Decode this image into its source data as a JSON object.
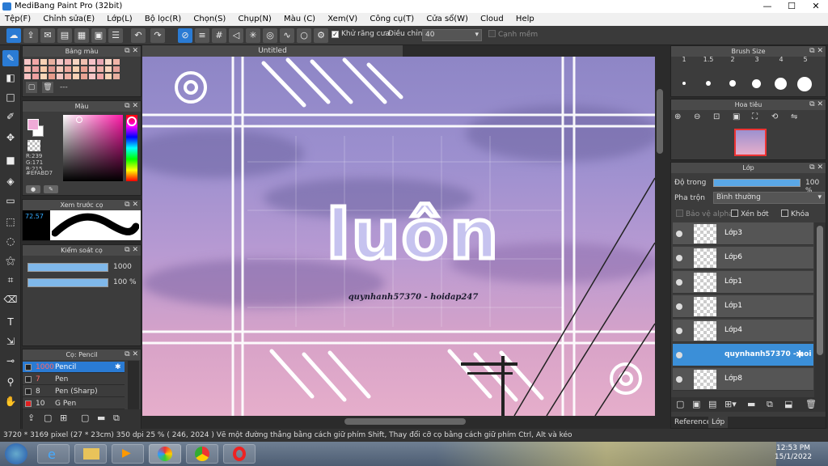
{
  "window": {
    "title": "MediBang Paint Pro (32bit)",
    "minimize": "—",
    "maximize": "☐",
    "close": "✕"
  },
  "menu": [
    "Tệp(F)",
    "Chỉnh sửa(E)",
    "Lớp(L)",
    "Bộ lọc(R)",
    "Chọn(S)",
    "Chụp(N)",
    "Màu (C)",
    "Xem(V)",
    "Công cụ(T)",
    "Cửa sổ(W)",
    "Cloud",
    "Help"
  ],
  "toolbar": {
    "antialias_label": "Khử răng cưa",
    "adjust_label": "Điều chỉnh",
    "adjust_value": "40",
    "edge_label": "Cạnh mềm"
  },
  "canvas": {
    "tab_title": "Untitled",
    "art_word": "luôn",
    "art_caption": "quynhanh57370 - hoidap247"
  },
  "palette_panel": {
    "title": "Bảng màu",
    "name": "---"
  },
  "color_panel": {
    "title": "Màu",
    "r": "R:239",
    "g": "G:171",
    "b": "B:215",
    "hex": "#EFABD7",
    "primary": "#EFABD7"
  },
  "preview_panel": {
    "title": "Xem trước cọ",
    "size": "72.57"
  },
  "control_panel": {
    "title": "Kiểm soát cọ",
    "size_value": "1000",
    "opacity_value": "100 %"
  },
  "brush_panel": {
    "title": "Cọ: Pencil",
    "brushes": [
      {
        "size": "1000",
        "name": "Pencil",
        "color": "#222222"
      },
      {
        "size": "7",
        "name": "Pen",
        "color": "#222222"
      },
      {
        "size": "8",
        "name": "Pen (Sharp)",
        "color": "#222222"
      },
      {
        "size": "10",
        "name": "G Pen",
        "color": "#e02020"
      }
    ]
  },
  "brush_size_panel": {
    "title": "Brush Size",
    "sizes": [
      "1",
      "1.5",
      "2",
      "3",
      "4",
      "5"
    ]
  },
  "navigator_panel": {
    "title": "Hoa tiêu"
  },
  "layer_panel": {
    "title": "Lớp",
    "opacity_label": "Độ trong",
    "opacity_value": "100 %",
    "blend_label": "Pha trộn",
    "blend_value": "Bình thường",
    "protect_alpha": "Bảo vệ alpha",
    "clip": "Xén bớt",
    "lock": "Khóa",
    "layers": [
      "Lớp3",
      "Lớp6",
      "Lớp1",
      "Lớp1",
      "Lớp4",
      "quynhanh57370 - hoi",
      "Lớp8"
    ],
    "tab_reference": "Reference",
    "tab_layer": "Lớp"
  },
  "status": {
    "text": "3720 * 3169 pixel   (27 * 23cm)   350 dpi   25 %   ( 246, 2024 )   Vẽ một đường thẳng bằng cách giữ phím Shift, Thay đổi cỡ cọ bằng cách giữ phím Ctrl, Alt và kéo"
  },
  "taskbar": {
    "time": "12:53 PM",
    "date": "15/1/2022"
  }
}
